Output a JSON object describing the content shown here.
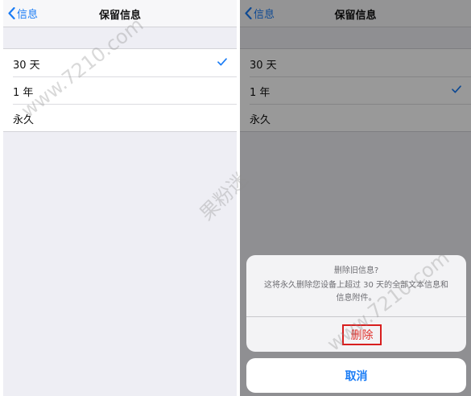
{
  "left_screen": {
    "nav": {
      "back_label": "信息",
      "title": "保留信息"
    },
    "options": [
      {
        "label": "30 天",
        "checked": true
      },
      {
        "label": "1 年",
        "checked": false
      },
      {
        "label": "永久",
        "checked": false
      }
    ]
  },
  "right_screen": {
    "nav": {
      "back_label": "信息",
      "title": "保留信息"
    },
    "options": [
      {
        "label": "30 天",
        "checked": false
      },
      {
        "label": "1 年",
        "checked": true
      },
      {
        "label": "永久",
        "checked": false
      }
    ],
    "alert": {
      "title": "删除旧信息?",
      "message": "这将永久删除您设备上超过 30 天的全部文本信息和信息附件。",
      "destructive_label": "删除",
      "cancel_label": "取消"
    }
  },
  "watermarks": {
    "site": "www.7210.com",
    "brand": "果粉迷"
  },
  "colors": {
    "accent": "#1a7cf5",
    "destructive": "#e0302b",
    "highlight_box": "#d81e1e",
    "background": "#eeeef4"
  }
}
